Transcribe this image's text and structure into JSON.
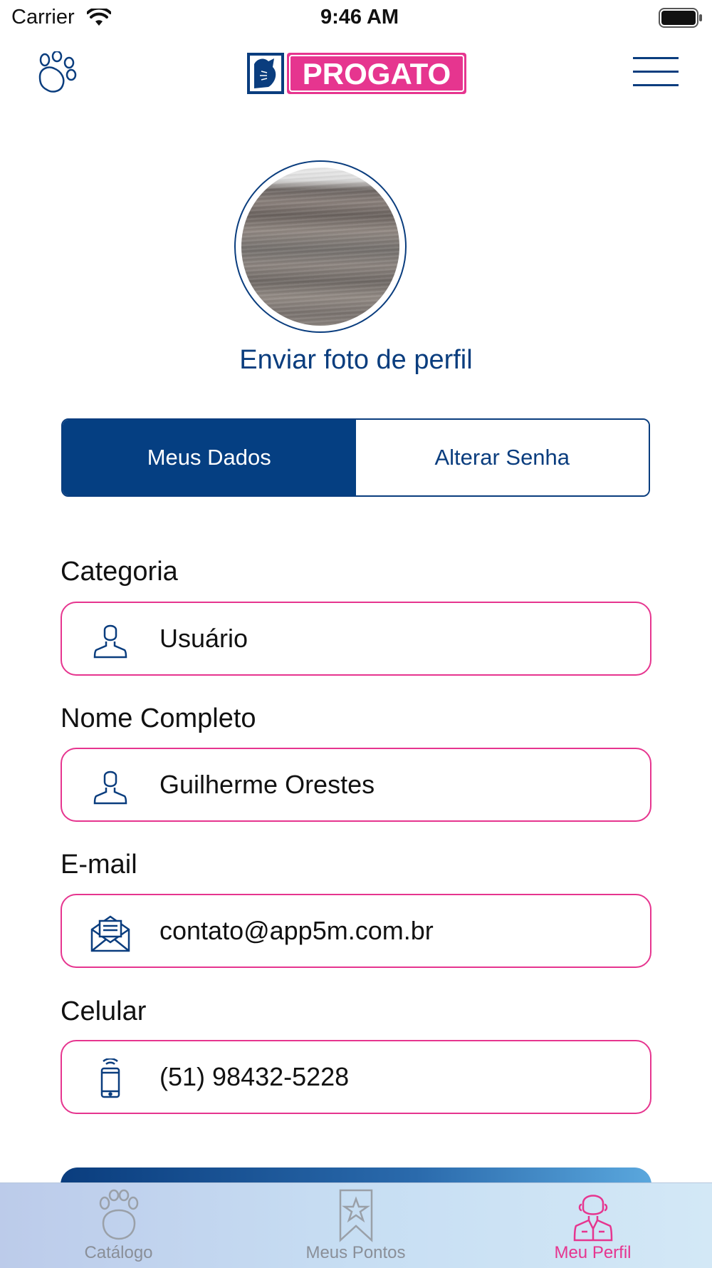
{
  "status_bar": {
    "carrier": "Carrier",
    "time": "9:46 AM"
  },
  "header": {
    "logo_text": "PROGATO"
  },
  "profile": {
    "upload_photo_label": "Enviar foto de perfil"
  },
  "segments": {
    "my_data": "Meus Dados",
    "change_password": "Alterar Senha",
    "selected": "my_data"
  },
  "form": {
    "category": {
      "label": "Categoria",
      "value": "Usuário",
      "icon": "user-icon"
    },
    "full_name": {
      "label": "Nome Completo",
      "value": "Guilherme Orestes",
      "icon": "user-icon"
    },
    "email": {
      "label": "E-mail",
      "value": "contato@app5m.com.br",
      "icon": "envelope-icon"
    },
    "phone": {
      "label": "Celular",
      "value": "(51) 98432-5228",
      "icon": "phone-icon"
    }
  },
  "tabbar": {
    "items": [
      {
        "label": "Catálogo",
        "icon": "paw-icon",
        "active": false
      },
      {
        "label": "Meus Pontos",
        "icon": "bookmark-star-icon",
        "active": false
      },
      {
        "label": "Meu Perfil",
        "icon": "profile-person-icon",
        "active": true
      }
    ]
  },
  "colors": {
    "primary": "#0a3d7e",
    "accent": "#e6358f",
    "segment_active": "#053f82"
  }
}
